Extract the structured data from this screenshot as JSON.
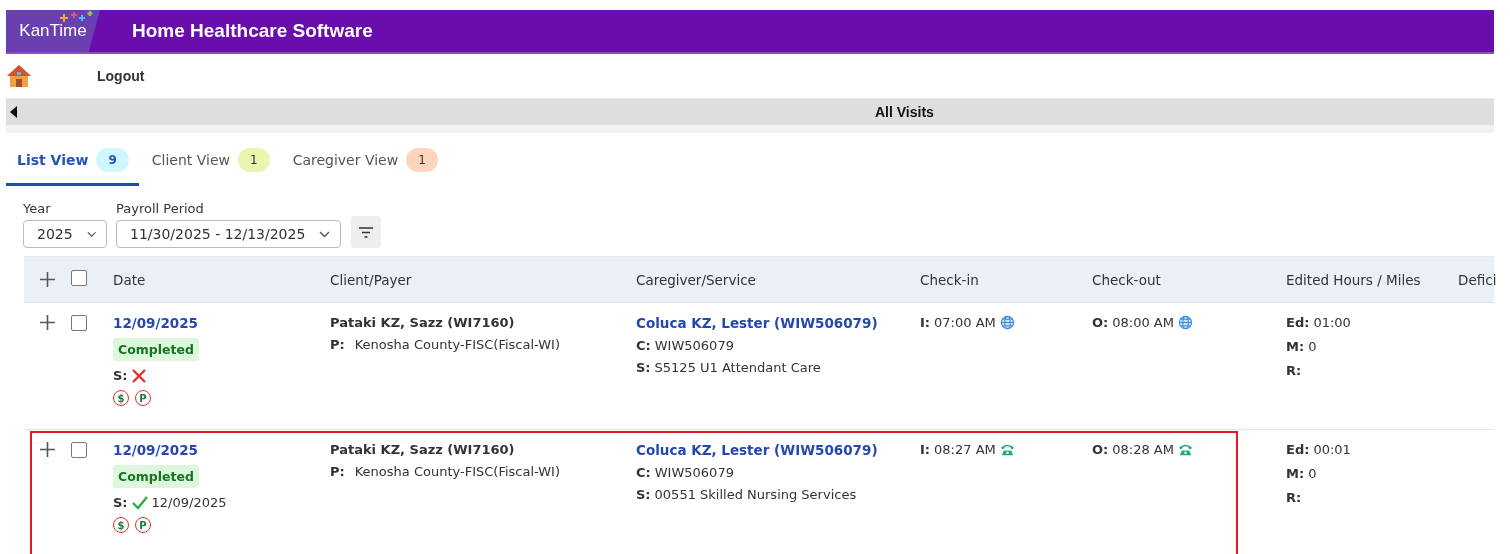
{
  "header": {
    "logo": "KanTime",
    "title": "Home Healthcare Software"
  },
  "nav": {
    "logout": "Logout"
  },
  "section_bar": {
    "title": "All Visits"
  },
  "tabs": [
    {
      "label": "List View",
      "count": "9",
      "color": "#cff7fd",
      "selected": true
    },
    {
      "label": "Client View",
      "count": "1",
      "color": "#eaf5b0",
      "selected": false
    },
    {
      "label": "Caregiver View",
      "count": "1",
      "color": "#fdd5bd",
      "selected": false
    }
  ],
  "filters": [
    {
      "label": "Year",
      "value": "2025"
    },
    {
      "label": "Payroll Period",
      "value": "11/30/2025 - 12/13/2025"
    }
  ],
  "table": {
    "select_all": {
      "checked": false
    },
    "columns": [
      "Date",
      "Client/Payer",
      "Caregiver/Service",
      "Check-in",
      "Check-out",
      "Edited Hours / Miles",
      "Defici"
    ],
    "rows": [
      {
        "checked": false,
        "labels": {
          "payer": "P:",
          "code": "C:",
          "service": "S:",
          "sign": "S:",
          "in": "I:",
          "out": "O:",
          "edited": "Ed:",
          "miles": "M:",
          "rate": "R:"
        },
        "date": "12/09/2025",
        "status": "Completed",
        "signed": false,
        "flags": [
          "$",
          "P"
        ],
        "client": "Pataki KZ, Sazz (WI7160)",
        "payer": "Kenosha County-FISC(Fiscal-WI)",
        "caregiver": "Coluca KZ, Lester (WIW506079)",
        "code": "WIW506079",
        "service": "S5125 U1 Attendant Care",
        "check_in": {
          "time": "07:00 AM",
          "kind": "web"
        },
        "check_out": {
          "time": "08:00 AM",
          "kind": "web"
        },
        "edited": "01:00",
        "miles": "0",
        "highlighted": false
      },
      {
        "checked": false,
        "labels": {
          "payer": "P:",
          "code": "C:",
          "service": "S:",
          "sign": "S:",
          "in": "I:",
          "out": "O:",
          "edited": "Ed:",
          "miles": "M:",
          "rate": "R:"
        },
        "date": "12/09/2025",
        "status": "Completed",
        "signed": true,
        "sign_date": "12/09/2025",
        "flags": [
          "$",
          "P"
        ],
        "client": "Pataki KZ, Sazz (WI7160)",
        "payer": "Kenosha County-FISC(Fiscal-WI)",
        "caregiver": "Coluca KZ, Lester (WIW506079)",
        "code": "WIW506079",
        "service": "00551 Skilled Nursing Services",
        "check_in": {
          "time": "08:27 AM",
          "kind": "phone"
        },
        "check_out": {
          "time": "08:28 AM",
          "kind": "phone"
        },
        "edited": "00:01",
        "miles": "0",
        "highlighted": true
      }
    ]
  }
}
